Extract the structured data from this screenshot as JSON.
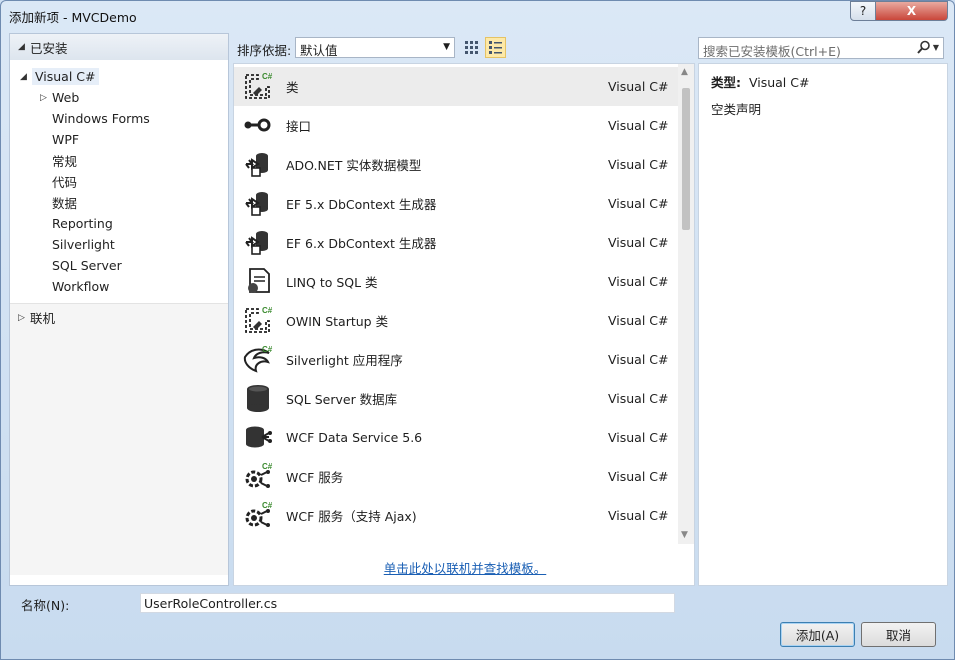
{
  "window": {
    "title": "添加新项 - MVCDemo",
    "help_label": "?",
    "close_label": "X"
  },
  "tree": {
    "installed_label": "已安装",
    "root": {
      "label": "Visual C#"
    },
    "children": [
      {
        "label": "Web",
        "expandable": true
      },
      {
        "label": "Windows Forms"
      },
      {
        "label": "WPF"
      },
      {
        "label": "常规"
      },
      {
        "label": "代码"
      },
      {
        "label": "数据"
      },
      {
        "label": "Reporting"
      },
      {
        "label": "Silverlight"
      },
      {
        "label": "SQL Server"
      },
      {
        "label": "Workflow"
      }
    ],
    "online_label": "联机"
  },
  "toolbar": {
    "sort_label": "排序依据:",
    "sort_value": "默认值"
  },
  "search": {
    "placeholder": "搜索已安装模板(Ctrl+E)"
  },
  "templates": [
    {
      "name": "类",
      "lang": "Visual C#",
      "icon": "class-icon",
      "selected": true
    },
    {
      "name": "接口",
      "lang": "Visual C#",
      "icon": "interface-icon"
    },
    {
      "name": "ADO.NET 实体数据模型",
      "lang": "Visual C#",
      "icon": "entity-model-icon"
    },
    {
      "name": "EF 5.x DbContext 生成器",
      "lang": "Visual C#",
      "icon": "dbcontext-generator-icon"
    },
    {
      "name": "EF 6.x DbContext 生成器",
      "lang": "Visual C#",
      "icon": "dbcontext-generator-icon"
    },
    {
      "name": "LINQ to SQL 类",
      "lang": "Visual C#",
      "icon": "linq-icon"
    },
    {
      "name": "OWIN Startup 类",
      "lang": "Visual C#",
      "icon": "class-icon"
    },
    {
      "name": "Silverlight 应用程序",
      "lang": "Visual C#",
      "icon": "silverlight-icon"
    },
    {
      "name": "SQL Server 数据库",
      "lang": "Visual C#",
      "icon": "database-icon"
    },
    {
      "name": "WCF Data Service 5.6",
      "lang": "Visual C#",
      "icon": "data-service-icon"
    },
    {
      "name": "WCF 服务",
      "lang": "Visual C#",
      "icon": "wcf-service-icon"
    },
    {
      "name": "WCF 服务（支持 Ajax)",
      "lang": "Visual C#",
      "icon": "wcf-service-icon"
    }
  ],
  "online_link": "单击此处以联机并查找模板。",
  "details": {
    "type_key": "类型:",
    "type_value": "Visual C#",
    "description": "空类声明"
  },
  "bottom": {
    "name_label": "名称(N):",
    "name_value": "UserRoleController.cs",
    "add_label": "添加(A)",
    "cancel_label": "取消"
  },
  "colors": {
    "accent": "#1a5fb4",
    "csharp_green": "#3a8a2e",
    "selection": "#e6eef8"
  }
}
